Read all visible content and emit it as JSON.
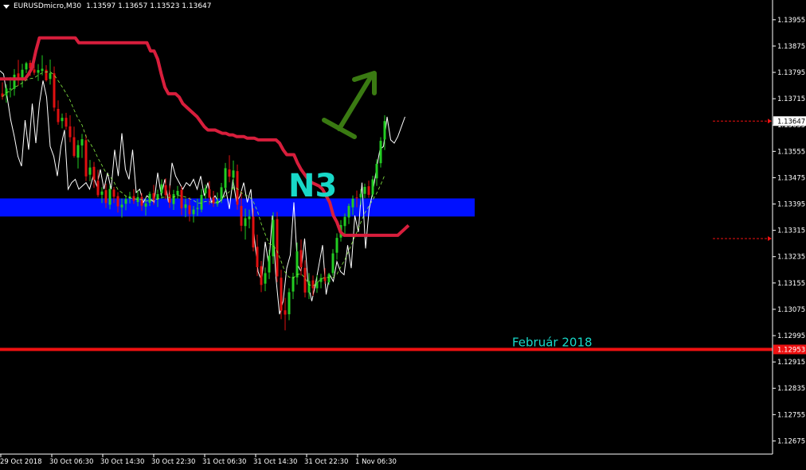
{
  "header": {
    "symbol_tf": "EURUSDmicro,M30",
    "ohlc": "1.13597 1.13657 1.13523 1.13647"
  },
  "colors": {
    "background": "#000000",
    "axis": "#ffffff",
    "bull": "#22cc22",
    "bear": "#e01010",
    "kijun": "#d81e3c",
    "support_zone": "#0010ff",
    "support_line": "#ee1111",
    "oscillator": "#ffffff",
    "tenkan": "#88ee44",
    "label_teal": "#18d8c8",
    "arrow": "#3a7a12"
  },
  "chart_data": {
    "type": "candlestick",
    "symbol": "EURUSDmicro",
    "timeframe": "M30",
    "ylim": [
      1.12635,
      1.14015
    ],
    "y_ticks": [
      "1.13955",
      "1.13875",
      "1.13795",
      "1.13715",
      "1.13635",
      "1.13555",
      "1.13475",
      "1.13395",
      "1.13315",
      "1.13235",
      "1.13155",
      "1.13075",
      "1.12995",
      "1.12915",
      "1.12835",
      "1.12755",
      "1.12675"
    ],
    "x_ticks": [
      "29 Oct 2018",
      "30 Oct 06:30",
      "30 Oct 14:30",
      "30 Oct 22:30",
      "31 Oct 06:30",
      "31 Oct 14:30",
      "31 Oct 22:30",
      "1 Nov 06:30"
    ],
    "current_price": "1.13647",
    "support_level": {
      "value": 1.12953,
      "label": "1.12953",
      "annotation": "Február 2018"
    },
    "zone": {
      "low": 1.13357,
      "high": 1.13412
    },
    "price_markers": [
      1.13647,
      1.1329
    ],
    "pattern_label": "N3",
    "arrow": "up",
    "candles": [
      {
        "o": 1.13731,
        "h": 1.13765,
        "l": 1.13712,
        "c": 1.13721
      },
      {
        "o": 1.13725,
        "h": 1.13759,
        "l": 1.13703,
        "c": 1.13746
      },
      {
        "o": 1.13743,
        "h": 1.13781,
        "l": 1.13719,
        "c": 1.13746
      },
      {
        "o": 1.13745,
        "h": 1.13805,
        "l": 1.13724,
        "c": 1.13788
      },
      {
        "o": 1.13792,
        "h": 1.13833,
        "l": 1.13755,
        "c": 1.13774
      },
      {
        "o": 1.13774,
        "h": 1.13821,
        "l": 1.13749,
        "c": 1.13803
      },
      {
        "o": 1.13804,
        "h": 1.13827,
        "l": 1.13793,
        "c": 1.13823
      },
      {
        "o": 1.13824,
        "h": 1.13832,
        "l": 1.13784,
        "c": 1.13807
      },
      {
        "o": 1.13804,
        "h": 1.13824,
        "l": 1.13787,
        "c": 1.13794
      },
      {
        "o": 1.13794,
        "h": 1.1382,
        "l": 1.13769,
        "c": 1.13802
      },
      {
        "o": 1.13799,
        "h": 1.13847,
        "l": 1.13786,
        "c": 1.13806
      },
      {
        "o": 1.13803,
        "h": 1.13817,
        "l": 1.13767,
        "c": 1.13771
      },
      {
        "o": 1.13775,
        "h": 1.13834,
        "l": 1.13758,
        "c": 1.13793
      },
      {
        "o": 1.13792,
        "h": 1.13813,
        "l": 1.13677,
        "c": 1.13688
      },
      {
        "o": 1.13684,
        "h": 1.1371,
        "l": 1.13636,
        "c": 1.13644
      },
      {
        "o": 1.13647,
        "h": 1.1367,
        "l": 1.13625,
        "c": 1.13657
      },
      {
        "o": 1.13657,
        "h": 1.13672,
        "l": 1.13621,
        "c": 1.1363
      },
      {
        "o": 1.13631,
        "h": 1.13665,
        "l": 1.13583,
        "c": 1.13598
      },
      {
        "o": 1.13598,
        "h": 1.1363,
        "l": 1.13536,
        "c": 1.13541
      },
      {
        "o": 1.13536,
        "h": 1.13589,
        "l": 1.13503,
        "c": 1.13574
      },
      {
        "o": 1.13573,
        "h": 1.13608,
        "l": 1.13535,
        "c": 1.13592
      },
      {
        "o": 1.13589,
        "h": 1.13605,
        "l": 1.13465,
        "c": 1.13479
      },
      {
        "o": 1.13484,
        "h": 1.13529,
        "l": 1.13464,
        "c": 1.13506
      },
      {
        "o": 1.13508,
        "h": 1.13523,
        "l": 1.13444,
        "c": 1.13469
      },
      {
        "o": 1.13466,
        "h": 1.13499,
        "l": 1.13416,
        "c": 1.13422
      },
      {
        "o": 1.13423,
        "h": 1.13446,
        "l": 1.13398,
        "c": 1.13433
      },
      {
        "o": 1.13437,
        "h": 1.13457,
        "l": 1.13383,
        "c": 1.13398
      },
      {
        "o": 1.13393,
        "h": 1.13452,
        "l": 1.13379,
        "c": 1.13441
      },
      {
        "o": 1.13439,
        "h": 1.13447,
        "l": 1.13398,
        "c": 1.13417
      },
      {
        "o": 1.13419,
        "h": 1.13431,
        "l": 1.13369,
        "c": 1.13388
      },
      {
        "o": 1.13385,
        "h": 1.13412,
        "l": 1.13354,
        "c": 1.13393
      },
      {
        "o": 1.13396,
        "h": 1.1342,
        "l": 1.13376,
        "c": 1.1341
      },
      {
        "o": 1.13412,
        "h": 1.13432,
        "l": 1.13397,
        "c": 1.13418
      },
      {
        "o": 1.13419,
        "h": 1.1344,
        "l": 1.13395,
        "c": 1.13405
      },
      {
        "o": 1.13401,
        "h": 1.13437,
        "l": 1.13388,
        "c": 1.13416
      },
      {
        "o": 1.13416,
        "h": 1.13428,
        "l": 1.13374,
        "c": 1.1339
      },
      {
        "o": 1.13387,
        "h": 1.13414,
        "l": 1.1336,
        "c": 1.13397
      },
      {
        "o": 1.13399,
        "h": 1.13433,
        "l": 1.13389,
        "c": 1.13426
      },
      {
        "o": 1.13428,
        "h": 1.13453,
        "l": 1.13392,
        "c": 1.13406
      },
      {
        "o": 1.13409,
        "h": 1.13439,
        "l": 1.13386,
        "c": 1.13425
      },
      {
        "o": 1.13428,
        "h": 1.1347,
        "l": 1.13411,
        "c": 1.13455
      },
      {
        "o": 1.13452,
        "h": 1.13473,
        "l": 1.13409,
        "c": 1.13422
      },
      {
        "o": 1.13424,
        "h": 1.13452,
        "l": 1.13383,
        "c": 1.13399
      },
      {
        "o": 1.13395,
        "h": 1.13438,
        "l": 1.13377,
        "c": 1.13425
      },
      {
        "o": 1.13422,
        "h": 1.1345,
        "l": 1.13411,
        "c": 1.13435
      },
      {
        "o": 1.13438,
        "h": 1.13449,
        "l": 1.13361,
        "c": 1.13382
      },
      {
        "o": 1.13383,
        "h": 1.13412,
        "l": 1.13355,
        "c": 1.13394
      },
      {
        "o": 1.13391,
        "h": 1.13415,
        "l": 1.13342,
        "c": 1.13364
      },
      {
        "o": 1.13364,
        "h": 1.13389,
        "l": 1.13339,
        "c": 1.13378
      },
      {
        "o": 1.1338,
        "h": 1.13411,
        "l": 1.13359,
        "c": 1.13383
      },
      {
        "o": 1.13378,
        "h": 1.13441,
        "l": 1.1337,
        "c": 1.13423
      },
      {
        "o": 1.13427,
        "h": 1.13454,
        "l": 1.1341,
        "c": 1.13443
      },
      {
        "o": 1.1344,
        "h": 1.13464,
        "l": 1.13393,
        "c": 1.13414
      },
      {
        "o": 1.13415,
        "h": 1.13435,
        "l": 1.13386,
        "c": 1.13397
      },
      {
        "o": 1.13395,
        "h": 1.1343,
        "l": 1.13387,
        "c": 1.13405
      },
      {
        "o": 1.13408,
        "h": 1.13459,
        "l": 1.13398,
        "c": 1.13446
      },
      {
        "o": 1.13444,
        "h": 1.1352,
        "l": 1.13432,
        "c": 1.13504
      },
      {
        "o": 1.135,
        "h": 1.13543,
        "l": 1.13461,
        "c": 1.13478
      },
      {
        "o": 1.13475,
        "h": 1.13527,
        "l": 1.13437,
        "c": 1.13497
      },
      {
        "o": 1.13495,
        "h": 1.13515,
        "l": 1.13378,
        "c": 1.13393
      },
      {
        "o": 1.13389,
        "h": 1.13434,
        "l": 1.13312,
        "c": 1.13329
      },
      {
        "o": 1.13328,
        "h": 1.13381,
        "l": 1.13287,
        "c": 1.13352
      },
      {
        "o": 1.13349,
        "h": 1.13378,
        "l": 1.13321,
        "c": 1.13357
      },
      {
        "o": 1.13356,
        "h": 1.13382,
        "l": 1.13251,
        "c": 1.13263
      },
      {
        "o": 1.13265,
        "h": 1.13302,
        "l": 1.13176,
        "c": 1.13203
      },
      {
        "o": 1.13206,
        "h": 1.13222,
        "l": 1.13127,
        "c": 1.13149
      },
      {
        "o": 1.13153,
        "h": 1.13202,
        "l": 1.1313,
        "c": 1.13185
      },
      {
        "o": 1.13187,
        "h": 1.13256,
        "l": 1.13167,
        "c": 1.13238
      },
      {
        "o": 1.13236,
        "h": 1.1337,
        "l": 1.13213,
        "c": 1.13347
      },
      {
        "o": 1.13349,
        "h": 1.13371,
        "l": 1.13158,
        "c": 1.13175
      },
      {
        "o": 1.13171,
        "h": 1.13195,
        "l": 1.13045,
        "c": 1.13071
      },
      {
        "o": 1.13072,
        "h": 1.1311,
        "l": 1.13011,
        "c": 1.13059
      },
      {
        "o": 1.1306,
        "h": 1.13139,
        "l": 1.13042,
        "c": 1.13127
      },
      {
        "o": 1.13129,
        "h": 1.13186,
        "l": 1.13106,
        "c": 1.13174
      },
      {
        "o": 1.13172,
        "h": 1.13278,
        "l": 1.1315,
        "c": 1.13251
      },
      {
        "o": 1.13255,
        "h": 1.13287,
        "l": 1.13178,
        "c": 1.13203
      },
      {
        "o": 1.13201,
        "h": 1.13224,
        "l": 1.13111,
        "c": 1.13126
      },
      {
        "o": 1.13126,
        "h": 1.13185,
        "l": 1.13106,
        "c": 1.13161
      },
      {
        "o": 1.13163,
        "h": 1.13178,
        "l": 1.13116,
        "c": 1.13139
      },
      {
        "o": 1.13139,
        "h": 1.13179,
        "l": 1.13125,
        "c": 1.13157
      },
      {
        "o": 1.13158,
        "h": 1.13183,
        "l": 1.13139,
        "c": 1.1317
      },
      {
        "o": 1.13173,
        "h": 1.132,
        "l": 1.13152,
        "c": 1.13161
      },
      {
        "o": 1.13157,
        "h": 1.13186,
        "l": 1.13149,
        "c": 1.13182
      },
      {
        "o": 1.13185,
        "h": 1.13258,
        "l": 1.13177,
        "c": 1.13245
      },
      {
        "o": 1.13247,
        "h": 1.13306,
        "l": 1.13226,
        "c": 1.13292
      },
      {
        "o": 1.13293,
        "h": 1.13346,
        "l": 1.13281,
        "c": 1.13331
      },
      {
        "o": 1.13328,
        "h": 1.13366,
        "l": 1.13303,
        "c": 1.13356
      },
      {
        "o": 1.13354,
        "h": 1.13396,
        "l": 1.13334,
        "c": 1.13389
      },
      {
        "o": 1.13385,
        "h": 1.13421,
        "l": 1.13362,
        "c": 1.13411
      },
      {
        "o": 1.13415,
        "h": 1.13436,
        "l": 1.13385,
        "c": 1.13414
      },
      {
        "o": 1.13415,
        "h": 1.1344,
        "l": 1.13392,
        "c": 1.13426
      },
      {
        "o": 1.13426,
        "h": 1.13457,
        "l": 1.13413,
        "c": 1.13447
      },
      {
        "o": 1.13449,
        "h": 1.13466,
        "l": 1.13414,
        "c": 1.13423
      },
      {
        "o": 1.13424,
        "h": 1.13481,
        "l": 1.13415,
        "c": 1.1347
      },
      {
        "o": 1.13473,
        "h": 1.13531,
        "l": 1.1345,
        "c": 1.13517
      },
      {
        "o": 1.13519,
        "h": 1.13598,
        "l": 1.13506,
        "c": 1.13587
      },
      {
        "o": 1.13591,
        "h": 1.13665,
        "l": 1.13559,
        "c": 1.13647
      }
    ],
    "kijun": [
      1.13775,
      1.13775,
      1.13775,
      1.13775,
      1.13775,
      1.13775,
      1.13775,
      1.13775,
      1.1379,
      1.1381,
      1.1386,
      1.139,
      1.139,
      1.139,
      1.139,
      1.139,
      1.139,
      1.139,
      1.139,
      1.139,
      1.139,
      1.139,
      1.13885,
      1.13885,
      1.13885,
      1.13885,
      1.13885,
      1.13885,
      1.13885,
      1.13885,
      1.13885,
      1.13885,
      1.13885,
      1.13885,
      1.13885,
      1.13885,
      1.13885,
      1.13885,
      1.13885,
      1.13885,
      1.13885,
      1.13885,
      1.1386,
      1.1386,
      1.13835,
      1.1379,
      1.1375,
      1.1373,
      1.1373,
      1.1373,
      1.1372,
      1.137,
      1.1369,
      1.1368,
      1.1367,
      1.1366,
      1.13645,
      1.1363,
      1.1362,
      1.1362,
      1.1362,
      1.13615,
      1.1361,
      1.1361,
      1.13605,
      1.13605,
      1.136,
      1.136,
      1.136,
      1.13595,
      1.13595,
      1.13595,
      1.1359,
      1.1359,
      1.1359,
      1.1359,
      1.1359,
      1.1359,
      1.1358,
      1.1356,
      1.13545,
      1.13545,
      1.13545,
      1.1352,
      1.135,
      1.13485,
      1.1347,
      1.1346,
      1.13455,
      1.1345,
      1.1344,
      1.1342,
      1.134,
      1.1336,
      1.1334,
      1.1331,
      1.133,
      1.133,
      1.133,
      1.133,
      1.133,
      1.133,
      1.133,
      1.133,
      1.133,
      1.133,
      1.133,
      1.133,
      1.133,
      1.133,
      1.133,
      1.133,
      1.1331,
      1.1332,
      1.1333
    ],
    "oscillator": [
      1.138,
      1.1379,
      1.1372,
      1.1365,
      1.136,
      1.1354,
      1.1351,
      1.1365,
      1.1356,
      1.137,
      1.1358,
      1.137,
      1.1377,
      1.1372,
      1.1357,
      1.1354,
      1.1348,
      1.1357,
      1.1362,
      1.1344,
      1.1346,
      1.1347,
      1.1344,
      1.1345,
      1.1346,
      1.1344,
      1.1348,
      1.1345,
      1.135,
      1.1344,
      1.1349,
      1.1344,
      1.1356,
      1.1348,
      1.1361,
      1.135,
      1.1347,
      1.1356,
      1.1343,
      1.1344,
      1.134,
      1.1342,
      1.1341,
      1.134,
      1.1349,
      1.1342,
      1.1347,
      1.134,
      1.1352,
      1.1348,
      1.1346,
      1.1344,
      1.1346,
      1.1345,
      1.1347,
      1.1344,
      1.1348,
      1.1342,
      1.1346,
      1.134,
      1.1342,
      1.134,
      1.1341,
      1.1344,
      1.1338,
      1.1347,
      1.134,
      1.1342,
      1.1346,
      1.134,
      1.1344,
      1.1329,
      1.1319,
      1.1316,
      1.1328,
      1.1321,
      1.1336,
      1.1317,
      1.1306,
      1.131,
      1.132,
      1.1324,
      1.134,
      1.1321,
      1.1319,
      1.1329,
      1.1315,
      1.131,
      1.1315,
      1.1321,
      1.1327,
      1.1312,
      1.1318,
      1.1316,
      1.1322,
      1.1319,
      1.1318,
      1.1327,
      1.132,
      1.1336,
      1.1331,
      1.1346,
      1.1326,
      1.1338,
      1.1343,
      1.135,
      1.1356,
      1.1357,
      1.1366,
      1.1359,
      1.1358,
      1.136,
      1.1363,
      1.1366
    ]
  }
}
